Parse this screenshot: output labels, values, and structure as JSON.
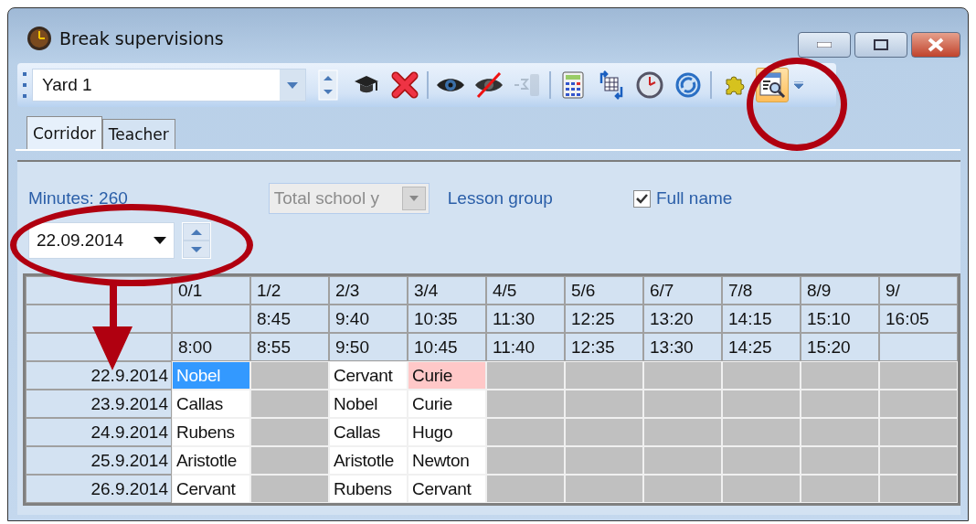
{
  "window": {
    "title": "Break supervisions"
  },
  "toolbar": {
    "combo_value": "Yard 1",
    "buttons": [
      {
        "kind": "spinner"
      },
      {
        "kind": "mortarboard"
      },
      {
        "kind": "delete"
      },
      {
        "kind": "separator"
      },
      {
        "kind": "eye"
      },
      {
        "kind": "eye-crossed"
      },
      {
        "kind": "counter",
        "disabled": true
      },
      {
        "kind": "separator"
      },
      {
        "kind": "calculator"
      },
      {
        "kind": "table-swap"
      },
      {
        "kind": "clock"
      },
      {
        "kind": "refresh"
      },
      {
        "kind": "separator"
      },
      {
        "kind": "puzzle"
      },
      {
        "kind": "report-search",
        "active": true
      }
    ]
  },
  "tabs": [
    {
      "label": "Corridor",
      "selected": true
    },
    {
      "label": "Teacher",
      "selected": false
    }
  ],
  "minutes": "Minutes: 260",
  "period_select": {
    "value": "Total school y",
    "disabled": true
  },
  "lesson_group": "Lesson group",
  "full_name": {
    "label": "Full name",
    "checked": true
  },
  "date_picker": {
    "value": "22.09.2014"
  },
  "grid": {
    "columns": [
      {
        "period": "0/1",
        "end": "8:00"
      },
      {
        "period": "1/2",
        "start": "8:45",
        "end": "8:55"
      },
      {
        "period": "2/3",
        "start": "9:40",
        "end": "9:50"
      },
      {
        "period": "3/4",
        "start": "10:35",
        "end": "10:45"
      },
      {
        "period": "4/5",
        "start": "11:30",
        "end": "11:40"
      },
      {
        "period": "5/6",
        "start": "12:25",
        "end": "12:35"
      },
      {
        "period": "6/7",
        "start": "13:20",
        "end": "13:30"
      },
      {
        "period": "7/8",
        "start": "14:15",
        "end": "14:25"
      },
      {
        "period": "8/9",
        "start": "15:10",
        "end": "15:20"
      },
      {
        "period": "9/",
        "start": "16:05"
      }
    ],
    "rows": [
      {
        "date": "22.9.2014",
        "cells": [
          {
            "kind": "selected",
            "text": "Nobel"
          },
          {
            "kind": "blocked"
          },
          {
            "kind": "normal",
            "text": "Cervant"
          },
          {
            "kind": "conflict",
            "text": "Curie"
          },
          {
            "kind": "blocked"
          },
          {
            "kind": "blocked"
          },
          {
            "kind": "blocked"
          },
          {
            "kind": "blocked"
          },
          {
            "kind": "blocked"
          },
          {
            "kind": "blocked"
          }
        ]
      },
      {
        "date": "23.9.2014",
        "cells": [
          {
            "kind": "normal",
            "text": "Callas"
          },
          {
            "kind": "blocked"
          },
          {
            "kind": "normal",
            "text": "Nobel"
          },
          {
            "kind": "normal",
            "text": "Curie"
          },
          {
            "kind": "blocked"
          },
          {
            "kind": "blocked"
          },
          {
            "kind": "blocked"
          },
          {
            "kind": "blocked"
          },
          {
            "kind": "blocked"
          },
          {
            "kind": "blocked"
          }
        ]
      },
      {
        "date": "24.9.2014",
        "cells": [
          {
            "kind": "normal",
            "text": "Rubens"
          },
          {
            "kind": "blocked"
          },
          {
            "kind": "normal",
            "text": "Callas"
          },
          {
            "kind": "normal",
            "text": "Hugo"
          },
          {
            "kind": "blocked"
          },
          {
            "kind": "blocked"
          },
          {
            "kind": "blocked"
          },
          {
            "kind": "blocked"
          },
          {
            "kind": "blocked"
          },
          {
            "kind": "blocked"
          }
        ]
      },
      {
        "date": "25.9.2014",
        "cells": [
          {
            "kind": "normal",
            "text": "Aristotle"
          },
          {
            "kind": "blocked"
          },
          {
            "kind": "normal",
            "text": "Aristotle"
          },
          {
            "kind": "normal",
            "text": "Newton"
          },
          {
            "kind": "blocked"
          },
          {
            "kind": "blocked"
          },
          {
            "kind": "blocked"
          },
          {
            "kind": "blocked"
          },
          {
            "kind": "blocked"
          },
          {
            "kind": "blocked"
          }
        ]
      },
      {
        "date": "26.9.2014",
        "cells": [
          {
            "kind": "normal",
            "text": "Cervant"
          },
          {
            "kind": "blocked"
          },
          {
            "kind": "normal",
            "text": "Rubens"
          },
          {
            "kind": "normal",
            "text": "Cervant"
          },
          {
            "kind": "blocked"
          },
          {
            "kind": "blocked"
          },
          {
            "kind": "blocked"
          },
          {
            "kind": "blocked"
          },
          {
            "kind": "blocked"
          },
          {
            "kind": "blocked"
          }
        ]
      }
    ]
  }
}
